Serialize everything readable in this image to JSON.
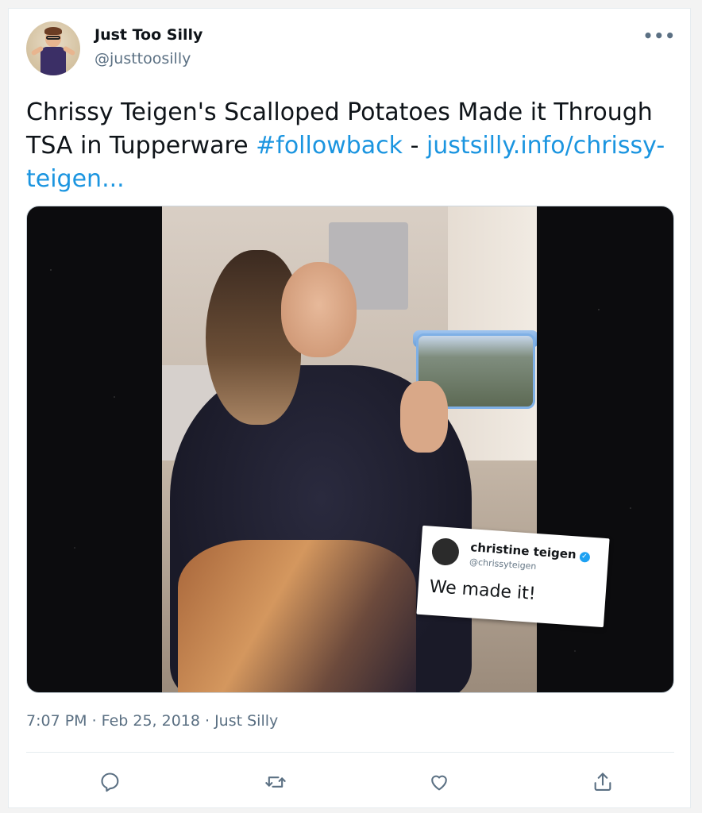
{
  "tweet": {
    "author_name": "Just Too Silly",
    "author_handle": "@justtoosilly",
    "text_plain": "Chrissy Teigen's Scalloped Potatoes Made it Through TSA in Tupperware ",
    "hashtag": "#followback",
    "separator": " - ",
    "link": "justsilly.info/chrissy-teigen...",
    "timestamp": "7:07 PM · Feb 25, 2018 · Just Silly"
  },
  "embedded_tweet": {
    "name": "christine teigen",
    "handle": "@chrissyteigen",
    "text": "We made it!",
    "verified_glyph": "✓"
  },
  "menu": {
    "more_label": "•••"
  },
  "icons": {
    "more": "more-options-icon",
    "reply": "reply-icon",
    "retweet": "retweet-icon",
    "like": "like-icon",
    "share": "share-icon"
  },
  "colors": {
    "link": "#1b95e0",
    "text": "#0f1419",
    "secondary": "#5b7083",
    "verified": "#1da1f2"
  }
}
